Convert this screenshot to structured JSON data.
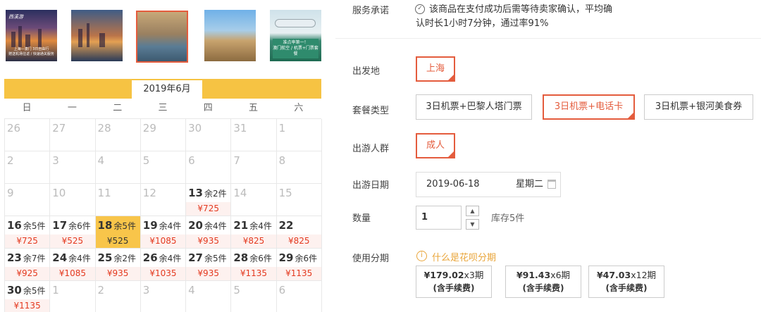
{
  "thumbnails": [
    {
      "brand": "西溪游",
      "caption": "上海—澳门 3日自由行",
      "caption2": "赠送机场往返 / 快速通关服务"
    },
    {
      "caption": ""
    },
    {
      "caption": ""
    },
    {
      "caption": ""
    },
    {
      "promo": "准点率第一！",
      "promo2": "澳门航空 / 机票+门票套餐"
    }
  ],
  "calendar": {
    "month": "2019年6月",
    "weekdays": [
      "日",
      "一",
      "二",
      "三",
      "四",
      "五",
      "六"
    ],
    "cells": [
      {
        "day": "26"
      },
      {
        "day": "27"
      },
      {
        "day": "28"
      },
      {
        "day": "29"
      },
      {
        "day": "30"
      },
      {
        "day": "31"
      },
      {
        "day": "1"
      },
      {
        "day": "2"
      },
      {
        "day": "3"
      },
      {
        "day": "4"
      },
      {
        "day": "5"
      },
      {
        "day": "6"
      },
      {
        "day": "7"
      },
      {
        "day": "8"
      },
      {
        "day": "9"
      },
      {
        "day": "10"
      },
      {
        "day": "11"
      },
      {
        "day": "12"
      },
      {
        "day": "13",
        "stock": "余2件",
        "price": "¥725"
      },
      {
        "day": "14"
      },
      {
        "day": "15"
      },
      {
        "day": "16",
        "stock": "余5件",
        "price": "¥725"
      },
      {
        "day": "17",
        "stock": "余6件",
        "price": "¥525"
      },
      {
        "day": "18",
        "stock": "余5件",
        "price": "¥525",
        "selected": true
      },
      {
        "day": "19",
        "stock": "余4件",
        "price": "¥1085"
      },
      {
        "day": "20",
        "stock": "余4件",
        "price": "¥935"
      },
      {
        "day": "21",
        "stock": "余4件",
        "price": "¥825"
      },
      {
        "day": "22",
        "stock": "",
        "price": "¥825"
      },
      {
        "day": "23",
        "stock": "余7件",
        "price": "¥925"
      },
      {
        "day": "24",
        "stock": "余4件",
        "price": "¥1085"
      },
      {
        "day": "25",
        "stock": "余2件",
        "price": "¥935"
      },
      {
        "day": "26",
        "stock": "余4件",
        "price": "¥1035"
      },
      {
        "day": "27",
        "stock": "余5件",
        "price": "¥935"
      },
      {
        "day": "28",
        "stock": "余6件",
        "price": "¥1135"
      },
      {
        "day": "29",
        "stock": "余6件",
        "price": "¥1135"
      },
      {
        "day": "30",
        "stock": "余5件",
        "price": "¥1135"
      },
      {
        "day": "1"
      },
      {
        "day": "2"
      },
      {
        "day": "3"
      },
      {
        "day": "4"
      },
      {
        "day": "5"
      },
      {
        "day": "6"
      }
    ]
  },
  "form": {
    "service": {
      "label": "服务承诺",
      "icon": "check-circle-icon",
      "text_line1": "该商品在支付成功后需等待卖家确认，平均确",
      "text_line2": "认时长1小时7分钟，通过率91%"
    },
    "departure": {
      "label": "出发地",
      "options": [
        "上海"
      ],
      "selected": 0
    },
    "package": {
      "label": "套餐类型",
      "options": [
        "3日机票+巴黎人塔门票",
        "3日机票+电话卡",
        "3日机票+银河美食券"
      ],
      "selected": 1
    },
    "traveler": {
      "label": "出游人群",
      "options": [
        "成人"
      ],
      "selected": 0
    },
    "date": {
      "label": "出游日期",
      "value": "2019-06-18",
      "weekday": "星期二"
    },
    "quantity": {
      "label": "数量",
      "value": "1",
      "stock": "库存5件",
      "up": "▲",
      "down": "▼"
    },
    "installment": {
      "label": "使用分期",
      "info_icon": "info-circle-icon",
      "link": "什么是花呗分期",
      "plans": [
        {
          "amount": "¥179.02",
          "periods": "x3期",
          "fee": "(含手续费)"
        },
        {
          "amount": "¥91.43",
          "periods": "x6期",
          "fee": "(含手续费)"
        },
        {
          "amount": "¥47.03",
          "periods": "x12期",
          "fee": "(含手续费)"
        }
      ]
    }
  },
  "colors": {
    "accent": "#e45c3d",
    "calendar_bar": "#f6c343",
    "price": "#e4391f",
    "link": "#e9a53a"
  }
}
